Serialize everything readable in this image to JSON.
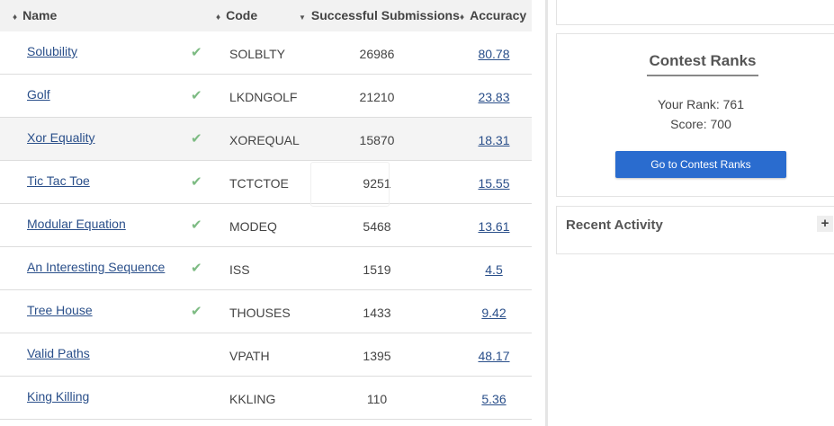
{
  "table": {
    "headers": {
      "name": "Name",
      "code": "Code",
      "submissions": "Successful Submissions",
      "accuracy": "Accuracy"
    },
    "rows": [
      {
        "name": "Solubility",
        "solved": true,
        "code": "SOLBLTY",
        "submissions": "26986",
        "accuracy": "80.78"
      },
      {
        "name": "Golf",
        "solved": true,
        "code": "LKDNGOLF",
        "submissions": "21210",
        "accuracy": "23.83"
      },
      {
        "name": "Xor Equality",
        "solved": true,
        "code": "XOREQUAL",
        "submissions": "15870",
        "accuracy": "18.31"
      },
      {
        "name": "Tic Tac Toe",
        "solved": true,
        "code": "TCTCTOE",
        "submissions": "9251",
        "accuracy": "15.55"
      },
      {
        "name": "Modular Equation",
        "solved": true,
        "code": "MODEQ",
        "submissions": "5468",
        "accuracy": "13.61"
      },
      {
        "name": "An Interesting Sequence",
        "solved": true,
        "code": "ISS",
        "submissions": "1519",
        "accuracy": "4.5"
      },
      {
        "name": "Tree House",
        "solved": true,
        "code": "THOUSES",
        "submissions": "1433",
        "accuracy": "9.42"
      },
      {
        "name": "Valid Paths",
        "solved": false,
        "code": "VPATH",
        "submissions": "1395",
        "accuracy": "48.17"
      },
      {
        "name": "King Killing",
        "solved": false,
        "code": "KKLING",
        "submissions": "110",
        "accuracy": "5.36"
      }
    ]
  },
  "icons": {
    "sort": "♦",
    "sort_desc": "▼",
    "check": "✔",
    "plus": "+"
  },
  "contest_ranks": {
    "title": "Contest Ranks",
    "rank_text": "Your Rank: 761",
    "score_text": "Score: 700",
    "button_label": "Go to Contest Ranks"
  },
  "recent_activity": {
    "title": "Recent Activity"
  },
  "colors": {
    "link": "#2a4f8a",
    "check": "#7dbb83",
    "button": "#2a6ccf",
    "header_bg": "#f2f2f2"
  }
}
